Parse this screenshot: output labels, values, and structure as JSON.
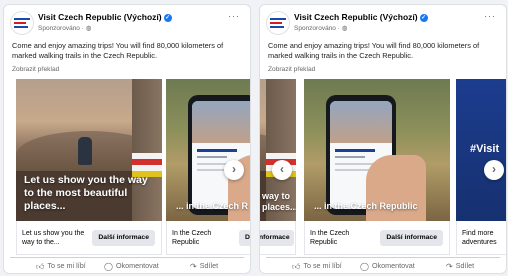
{
  "posts": [
    {
      "page_name": "Visit Czech Republic (Výchozí)",
      "sponsored": "Sponzorováno · ",
      "more": "···",
      "body": "Come and enjoy amazing trips! You will find 80,000 kilometers of marked walking trails in the Czech Republic.",
      "see_translation": "Zobrazit překlad",
      "cards": [
        {
          "overlay": "Let us show you the way to the most beautiful places...",
          "title": "Let us show you the way to the...",
          "button": "Další informace"
        },
        {
          "overlay": "... in the Czech R",
          "title": "In the Czech Republic",
          "button": "D"
        }
      ],
      "nav_next": "›",
      "actions": {
        "like": "To se mi líbí",
        "comment": "Okomentovat",
        "share": "Sdílet"
      }
    },
    {
      "page_name": "Visit Czech Republic (Výchozí)",
      "sponsored": "Sponzorováno · ",
      "more": "···",
      "body": "Come and enjoy amazing trips! You will find 80,000 kilometers of marked walking trails in the Czech Republic.",
      "see_translation": "Zobrazit překlad",
      "cards": [
        {
          "overlay": "way to places...",
          "title": "",
          "button": "nformace"
        },
        {
          "overlay": "... in the Czech Republic",
          "title": "In the Czech Republic",
          "button": "Další informace"
        },
        {
          "overlay": "#Visit",
          "title": "Find more adventures",
          "button": ""
        }
      ],
      "nav_prev": "‹",
      "nav_next": "›",
      "actions": {
        "like": "To se mi líbí",
        "comment": "Okomentovat",
        "share": "Sdílet"
      }
    }
  ],
  "colors": {
    "accent": "#1877f2",
    "secondary_text": "#65676b",
    "button_bg": "#e4e6eb"
  },
  "icons": {
    "verified": "check-badge-icon",
    "globe": "globe-icon",
    "like": "thumbs-up-icon",
    "comment": "comment-icon",
    "share": "share-icon"
  }
}
